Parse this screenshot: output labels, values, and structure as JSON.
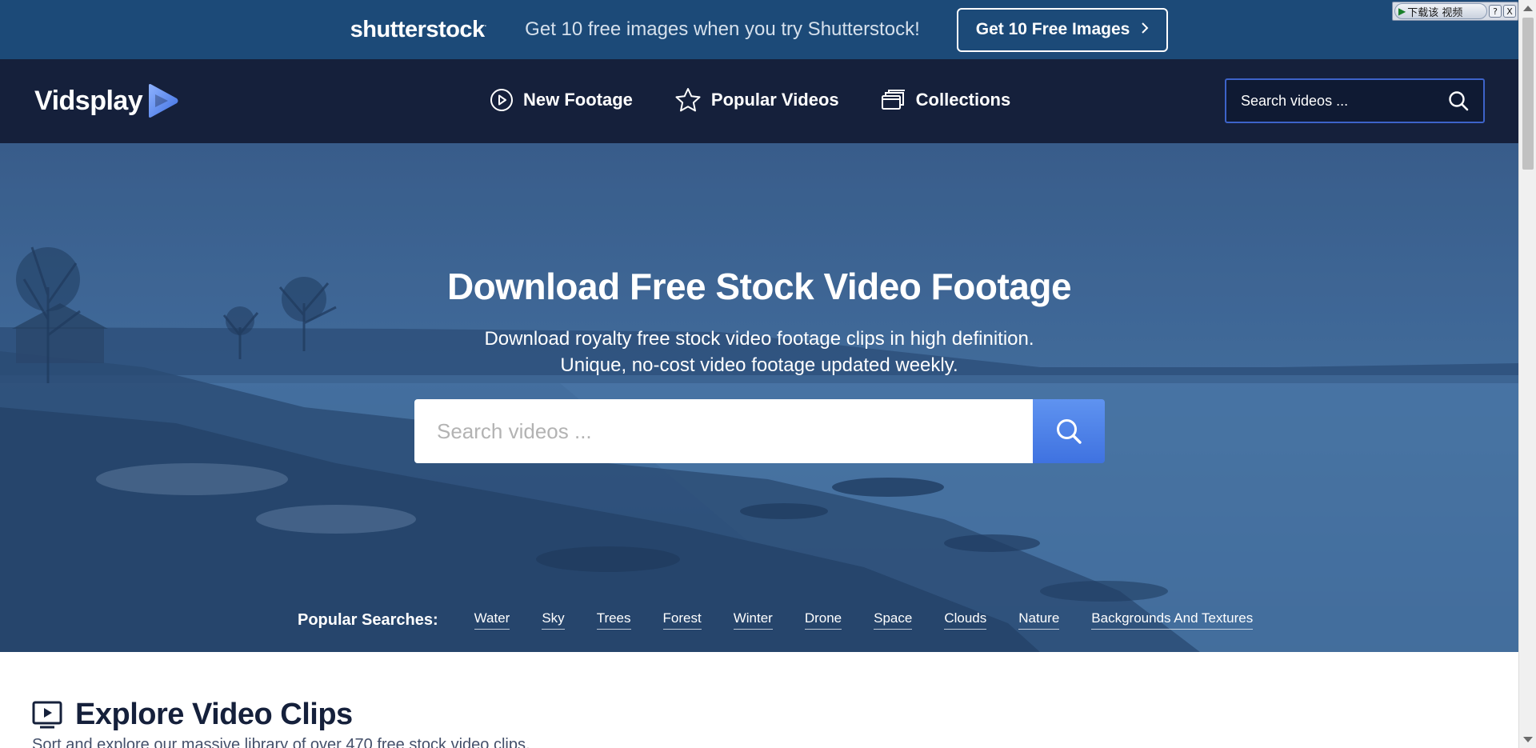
{
  "promo": {
    "logo": "shutterstock",
    "text": "Get 10 free images when you try Shutterstock!",
    "button_label": "Get 10 Free Images",
    "button_icon": "chevron-right-icon"
  },
  "download_widget": {
    "label": "下载该 视频",
    "help": "?",
    "close": "X"
  },
  "nav": {
    "brand": "Vidsplay",
    "links": [
      {
        "label": "New Footage",
        "icon": "play-circle-icon"
      },
      {
        "label": "Popular Videos",
        "icon": "star-icon"
      },
      {
        "label": "Collections",
        "icon": "collections-icon"
      }
    ],
    "search_placeholder": "Search videos ...",
    "search_icon": "search-icon"
  },
  "hero": {
    "title": "Download Free Stock Video Footage",
    "subtitle_line1": "Download royalty free stock video footage clips in high definition.",
    "subtitle_line2": "Unique, no-cost video footage updated weekly.",
    "search_placeholder": "Search videos ...",
    "popular_label": "Popular Searches:",
    "popular_tags": [
      "Water",
      "Sky",
      "Trees",
      "Forest",
      "Winter",
      "Drone",
      "Space",
      "Clouds",
      "Nature",
      "Backgrounds And Textures"
    ]
  },
  "explore": {
    "title": "Explore Video Clips",
    "subtitle": "Sort and explore our massive library of over 470 free stock video clips.",
    "icon": "video-icon"
  },
  "colors": {
    "promo_bg": "#1c4a78",
    "nav_bg": "#15203b",
    "accent": "#4a7de8",
    "hero_overlay": "#3f6898"
  }
}
